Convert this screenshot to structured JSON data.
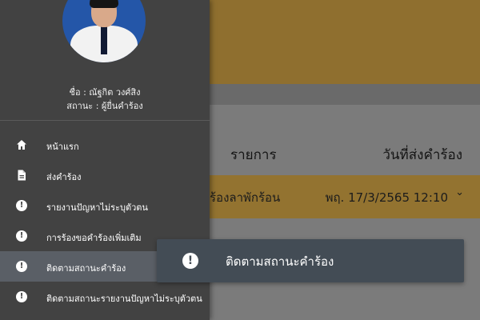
{
  "profile": {
    "name_line": "ชื่อ : ณัฐกิต วงศ์สิง",
    "status_line": "สถานะ : ผู้ยื่นคำร้อง"
  },
  "menu": {
    "items": [
      {
        "label": "หน้าแรก",
        "icon": "home-icon"
      },
      {
        "label": "ส่งคำร้อง",
        "icon": "document-icon"
      },
      {
        "label": "รายงานปัญหาไม่ระบุตัวตน",
        "icon": "alert-icon"
      },
      {
        "label": "การร้องขอคำร้องเพิ่มเติม",
        "icon": "alert-icon"
      },
      {
        "label": "ติดตามสถานะคำร้อง",
        "icon": "alert-icon",
        "active": true
      },
      {
        "label": "ติดตามสถานะรายงานปัญหาไม่ระบุตัวตน",
        "icon": "alert-icon"
      }
    ]
  },
  "tooltip": {
    "label": "ติดตามสถานะคำร้อง",
    "icon": "alert-icon"
  },
  "table": {
    "headers": [
      "รายการ",
      "วันที่ส่งคำร้อง"
    ],
    "rows": [
      {
        "type": "ร้องลาพักร้อน",
        "date": "พฤ. 17/3/2565 12:10"
      }
    ]
  },
  "colors": {
    "drawer_bg": "#424242",
    "accent": "#937330",
    "tooltip_bg": "#434c55"
  }
}
